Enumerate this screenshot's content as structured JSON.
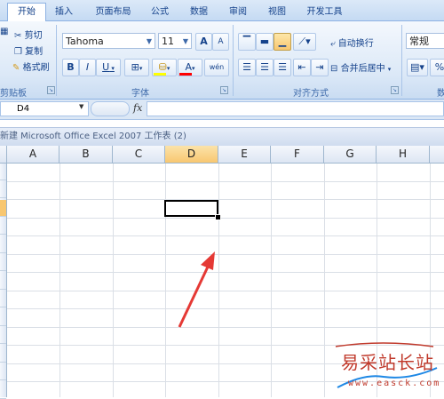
{
  "tabs": [
    "开始",
    "插入",
    "页面布局",
    "公式",
    "数据",
    "审阅",
    "视图",
    "开发工具"
  ],
  "clipboard": {
    "cut": "剪切",
    "copy": "复制",
    "painter": "格式刷",
    "label": "剪贴板"
  },
  "font": {
    "name": "Tahoma",
    "size": "11",
    "grow": "A",
    "shrink": "A",
    "bold": "B",
    "italic": "I",
    "underline": "U",
    "fontcolor_letter": "A",
    "phonetic": "wén",
    "label": "字体"
  },
  "alignment": {
    "wrap": "自动换行",
    "merge": "合并后居中",
    "label": "对齐方式"
  },
  "number": {
    "format": "常规",
    "percent": "%",
    "label_partial": "数"
  },
  "namebox": {
    "value": "D4"
  },
  "fx_label": "fx",
  "window_title": "新建 Microsoft Office Excel 2007 工作表 (2)",
  "columns": [
    "A",
    "B",
    "C",
    "D",
    "E",
    "F",
    "G",
    "H"
  ],
  "selected_column": "D",
  "selected_cell": "D4",
  "colors": {
    "accent": "#f8c770",
    "arrow": "#e53935",
    "ribbon": "#dbe8f7"
  },
  "watermark": {
    "text": "易采站长站",
    "url": "www.easck.com"
  }
}
